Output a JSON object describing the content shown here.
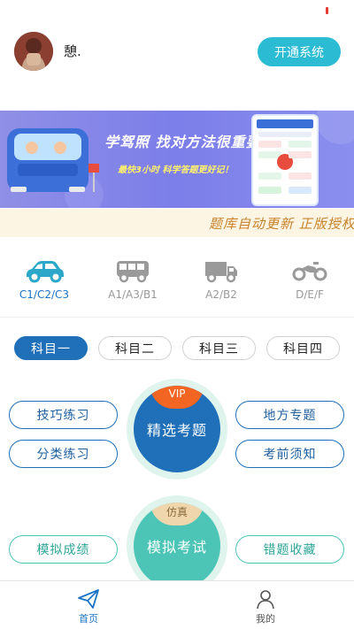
{
  "header": {
    "username": "憩.",
    "open_button": "开通系统"
  },
  "banner": {
    "title": "学驾照 找对方法很重要",
    "subtitle": "最快3小时 科学答题更好记！"
  },
  "marquee": {
    "text": "题库自动更新 正版授权"
  },
  "licenses": [
    {
      "label": "C1/C2/C3",
      "icon": "car-icon",
      "active": true
    },
    {
      "label": "A1/A3/B1",
      "icon": "bus-icon",
      "active": false
    },
    {
      "label": "A2/B2",
      "icon": "truck-icon",
      "active": false
    },
    {
      "label": "D/E/F",
      "icon": "motorcycle-icon",
      "active": false
    }
  ],
  "subjects": [
    "科目一",
    "科目二",
    "科目三",
    "科目四"
  ],
  "practice": {
    "skill": "技巧练习",
    "category": "分类练习",
    "featured": "精选考题",
    "vip_badge": "VIP",
    "local": "地方专题",
    "pre_exam": "考前须知",
    "mock_score": "模拟成绩",
    "mock_exam": "模拟考试",
    "sim_badge": "仿真",
    "mistakes": "错题收藏"
  },
  "bottom_nav": {
    "home": "首页",
    "mine": "我的"
  },
  "colors": {
    "primary": "#1f6fb9",
    "teal": "#4cc5b7",
    "accent": "#2bbcd4",
    "vip": "#f26522"
  }
}
